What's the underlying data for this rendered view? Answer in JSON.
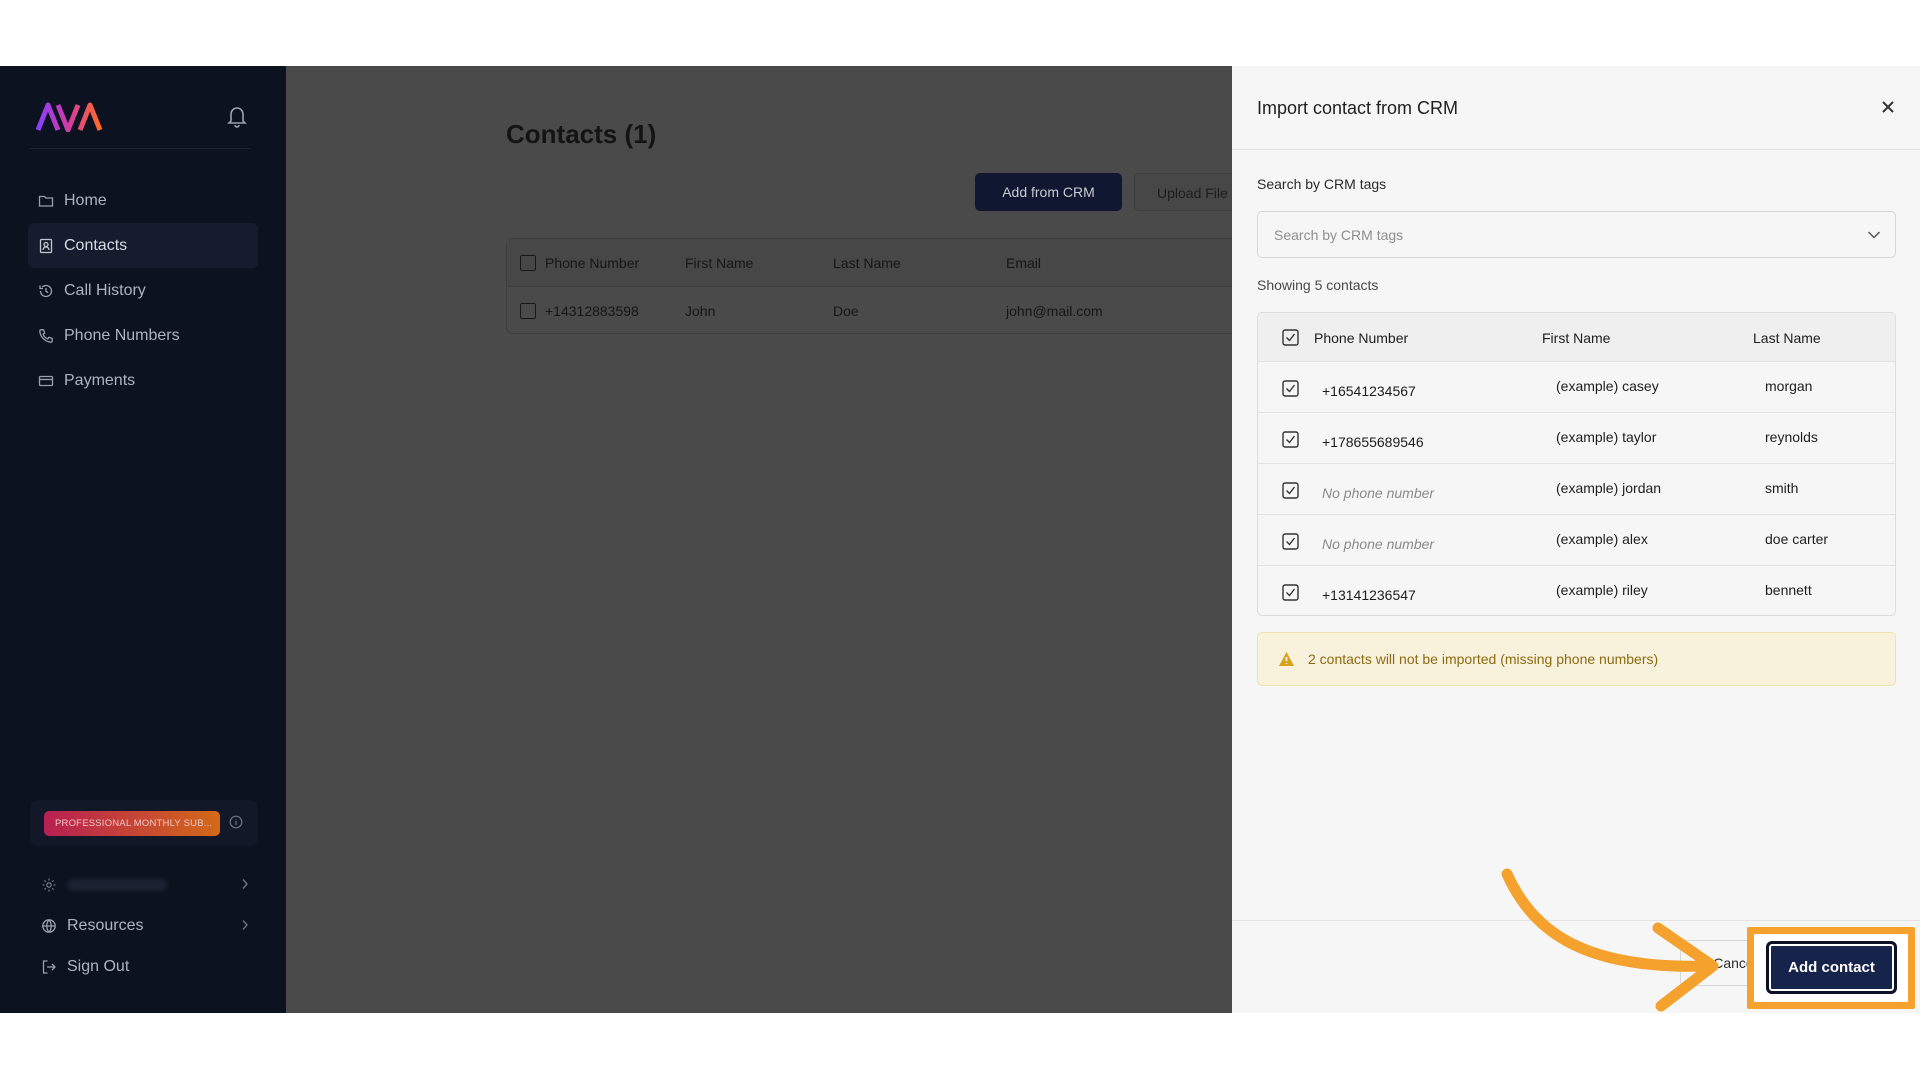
{
  "app": {
    "logo_text": "AVA",
    "accent_colors": {
      "brand_purple": "#8b3dff",
      "brand_orange": "#ff6a2a",
      "primary_navy": "#16234a",
      "highlight_orange": "#f4a22d"
    }
  },
  "sidebar": {
    "items": [
      {
        "label": "Home",
        "icon": "folder-icon",
        "active": false
      },
      {
        "label": "Contacts",
        "icon": "contact-book-icon",
        "active": true
      },
      {
        "label": "Call History",
        "icon": "history-icon",
        "active": false
      },
      {
        "label": "Phone Numbers",
        "icon": "phone-icon",
        "active": false
      },
      {
        "label": "Payments",
        "icon": "card-icon",
        "active": false
      }
    ],
    "plan_badge": "PROFESSIONAL MONTHLY SUB...",
    "bottom": {
      "resources_label": "Resources",
      "signout_label": "Sign Out"
    }
  },
  "main": {
    "title": "Contacts (1)",
    "add_from_crm_label": "Add from CRM",
    "upload_file_label": "Upload File",
    "table": {
      "headers": [
        "Phone Number",
        "First Name",
        "Last Name",
        "Email"
      ],
      "rows": [
        {
          "phone": "+14312883598",
          "first": "John",
          "last": "Doe",
          "email": "john@mail.com"
        }
      ]
    }
  },
  "drawer": {
    "title": "Import contact from CRM",
    "tags_label": "Search by CRM tags",
    "tags_placeholder": "Search by CRM tags",
    "showing_text": "Showing 5 contacts",
    "table": {
      "headers": [
        "Phone Number",
        "First Name",
        "Last Name"
      ],
      "rows": [
        {
          "phone": "+16541234567",
          "phone_missing": false,
          "first": "(example) casey",
          "last": "morgan",
          "checked": true
        },
        {
          "phone": "+178655689546",
          "phone_missing": false,
          "first": "(example) taylor",
          "last": "reynolds",
          "checked": true
        },
        {
          "phone": "No phone number",
          "phone_missing": true,
          "first": "(example) jordan",
          "last": "smith",
          "checked": true
        },
        {
          "phone": "No phone number",
          "phone_missing": true,
          "first": "(example) alex",
          "last": "doe carter",
          "checked": true
        },
        {
          "phone": "+13141236547",
          "phone_missing": false,
          "first": "(example) riley",
          "last": "bennett",
          "checked": true
        }
      ]
    },
    "warning_text": "2 contacts will not be imported (missing phone numbers)",
    "cancel_label": "Cancel",
    "add_label": "Add contact"
  }
}
